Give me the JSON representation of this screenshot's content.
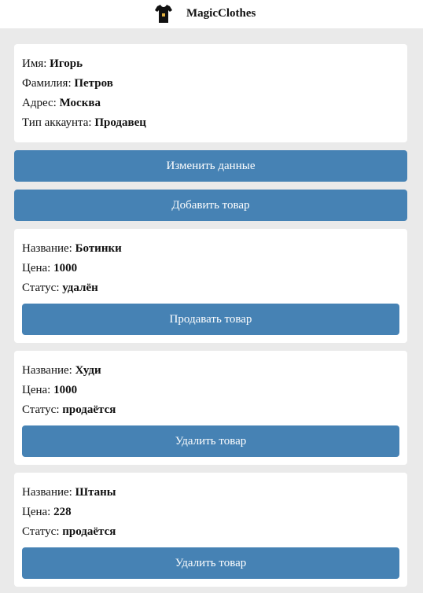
{
  "header": {
    "brand": "MagicClothes",
    "logo_icon": "tshirt-icon"
  },
  "profile": {
    "name_label": "Имя: ",
    "name_value": "Игорь",
    "surname_label": "Фамилия: ",
    "surname_value": "Петров",
    "address_label": "Адрес: ",
    "address_value": "Москва",
    "account_label": "Тип аккаунта: ",
    "account_value": "Продавец"
  },
  "actions": {
    "edit_label": "Изменить данные",
    "add_label": "Добавить товар"
  },
  "products": [
    {
      "title_label": "Название: ",
      "title_value": "Ботинки",
      "price_label": "Цена: ",
      "price_value": "1000",
      "status_label": "Статус: ",
      "status_value": "удалён",
      "button_label": "Продавать товар"
    },
    {
      "title_label": "Название: ",
      "title_value": "Худи",
      "price_label": "Цена: ",
      "price_value": "1000",
      "status_label": "Статус: ",
      "status_value": "продаётся",
      "button_label": "Удалить товар"
    },
    {
      "title_label": "Название: ",
      "title_value": "Штаны",
      "price_label": "Цена: ",
      "price_value": "228",
      "status_label": "Статус: ",
      "status_value": "продаётся",
      "button_label": "Удалить товар"
    }
  ],
  "colors": {
    "accent": "#4682b4",
    "background": "#eaeaea",
    "card": "#ffffff"
  }
}
